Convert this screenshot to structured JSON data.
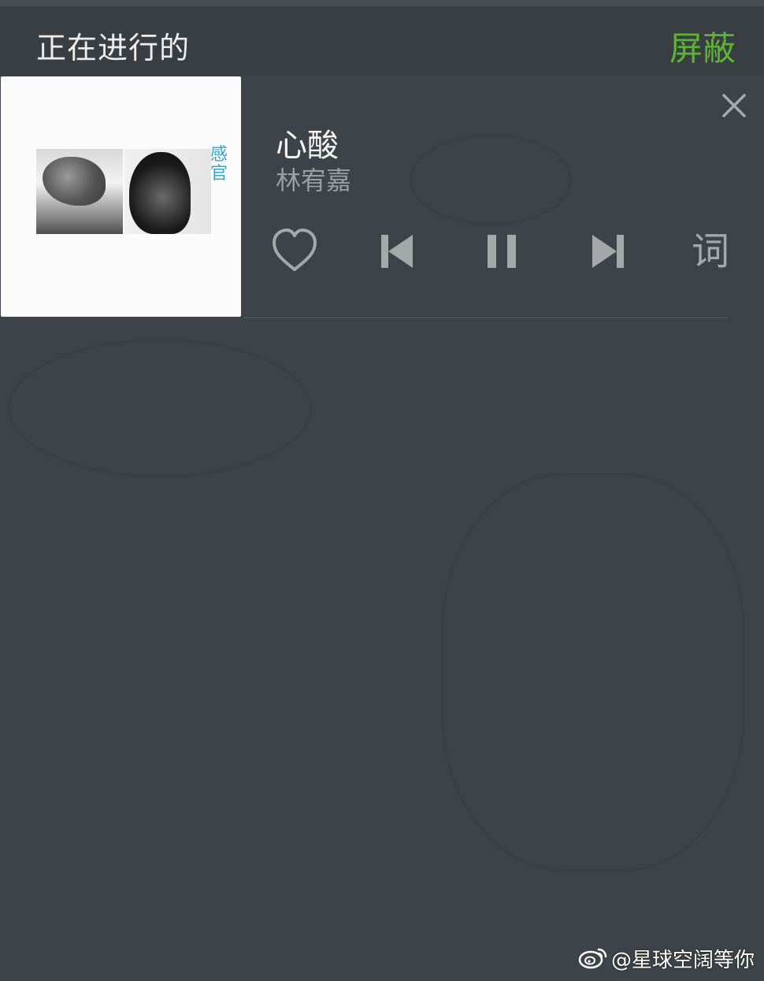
{
  "header": {
    "title": "正在进行的",
    "action_label": "屏蔽",
    "action_color": "#5cb531"
  },
  "player": {
    "song_title": "心酸",
    "artist": "林宥嘉",
    "album_art_text": "感官",
    "close_icon": "close-icon",
    "controls": {
      "like_icon": "heart-icon",
      "prev_icon": "skip-previous-icon",
      "pause_icon": "pause-icon",
      "next_icon": "skip-next-icon",
      "lyrics_label": "词"
    }
  },
  "watermark": {
    "logo": "weibo-logo",
    "text": "@星球空阔等你"
  }
}
